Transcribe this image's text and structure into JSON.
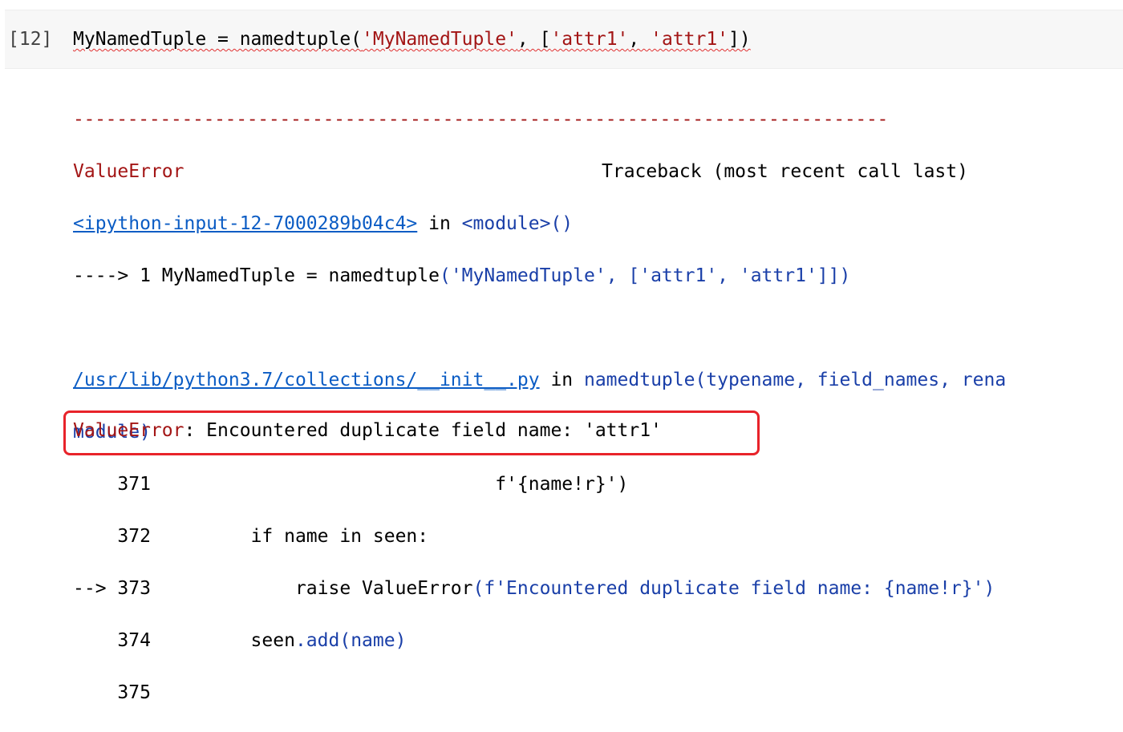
{
  "cell": {
    "prompt": "[12]",
    "code_var": "MyNamedTuple = namedtuple(",
    "code_str1": "'MyNamedTuple'",
    "code_mid": ", [",
    "code_str2": "'attr1'",
    "code_comma": ", ",
    "code_str3": "'attr1'",
    "code_end": "])"
  },
  "traceback": {
    "separator": "---------------------------------------------------------------------------",
    "error_type": "ValueError",
    "header_right": "Traceback (most recent call last)",
    "frame1_link": "<ipython-input-12-7000289b04c4>",
    "frame1_in": " in ",
    "frame1_module": "<module>()",
    "frame1_arrow": "----> 1 MyNamedTuple = namedtuple",
    "frame1_paren": "(",
    "frame1_args": "'MyNamedTuple', ['attr1', 'attr1']",
    "frame1_close": "])",
    "frame2_link": "/usr/lib/python3.7/collections/__init__.py",
    "frame2_in": " in ",
    "frame2_func": "namedtuple(typename, field_names, rena",
    "frame2_cont": "module)",
    "line371": "    371                               f'{name!r}')",
    "line372_num": "    372         ",
    "line372_code": "if name in seen:",
    "line373_arrow": "--> 373             raise ValueError",
    "line373_args": "(f'Encountered duplicate field name: {name!r}')",
    "line374_num": "    374         seen",
    "line374_code": ".add(name)",
    "line375": "    375"
  },
  "final_error": {
    "type": "ValueError",
    "message": ": Encountered duplicate field name: 'attr1'"
  }
}
